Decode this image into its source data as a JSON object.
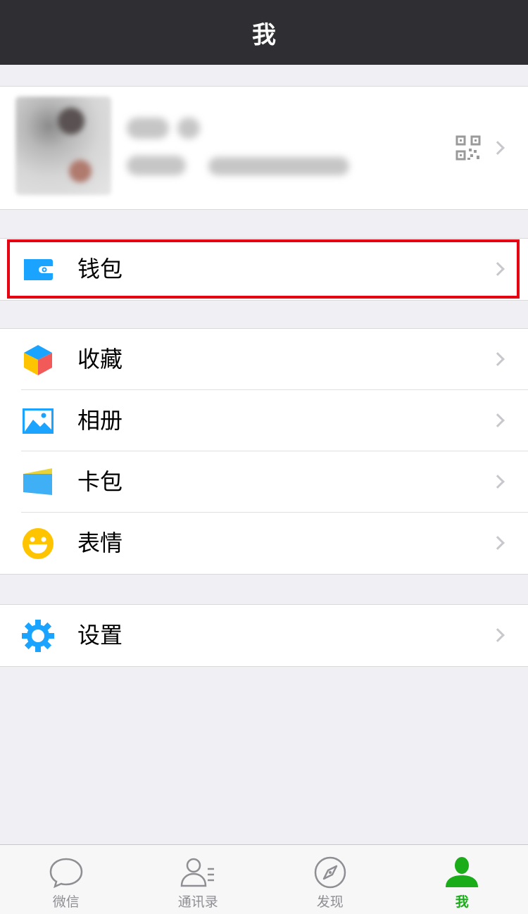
{
  "header": {
    "title": "我"
  },
  "profile": {
    "qr_icon": "qr-code-icon"
  },
  "menu": {
    "wallet": {
      "label": "钱包",
      "icon": "wallet-icon"
    },
    "favorites": {
      "label": "收藏",
      "icon": "cube-icon"
    },
    "album": {
      "label": "相册",
      "icon": "photo-icon"
    },
    "cards": {
      "label": "卡包",
      "icon": "card-wallet-icon"
    },
    "stickers": {
      "label": "表情",
      "icon": "smile-icon"
    },
    "settings": {
      "label": "设置",
      "icon": "gear-icon"
    }
  },
  "tabs": [
    {
      "label": "微信",
      "icon": "chat-bubble-icon",
      "active": false
    },
    {
      "label": "通讯录",
      "icon": "contacts-icon",
      "active": false
    },
    {
      "label": "发现",
      "icon": "compass-icon",
      "active": false
    },
    {
      "label": "我",
      "icon": "person-icon",
      "active": true
    }
  ],
  "colors": {
    "header_bg": "#2e2e33",
    "accent_green": "#1aad19",
    "icon_blue": "#1aa3ff",
    "highlight_red": "#e60012"
  }
}
